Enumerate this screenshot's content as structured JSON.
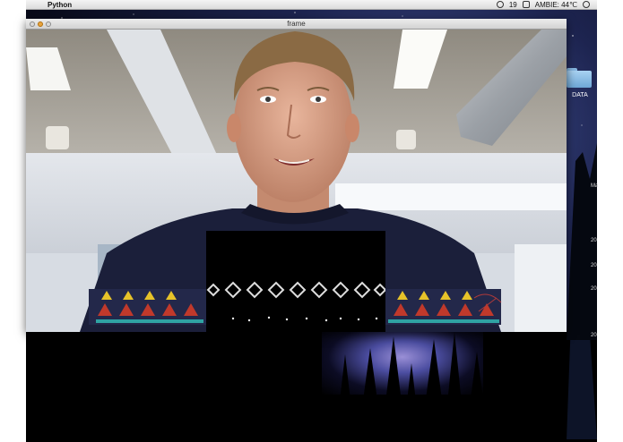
{
  "menubar": {
    "app_name": "Python",
    "status_number": "19",
    "status_text": "AMBIE: 44℃"
  },
  "window": {
    "title": "frame"
  },
  "desktop": {
    "folder_label": "DATA",
    "edge_labels": [
      "Ma",
      "20",
      "20",
      "20",
      "20"
    ]
  },
  "icons": {
    "apple": "apple-logo-icon",
    "folder": "folder-icon",
    "display": "display-icon",
    "power": "power-icon"
  },
  "colors": {
    "sweater": "#1b1f3a",
    "pattern_red": "#c0392b",
    "pattern_yellow": "#e6c229",
    "pattern_teal": "#2fa3a3"
  }
}
